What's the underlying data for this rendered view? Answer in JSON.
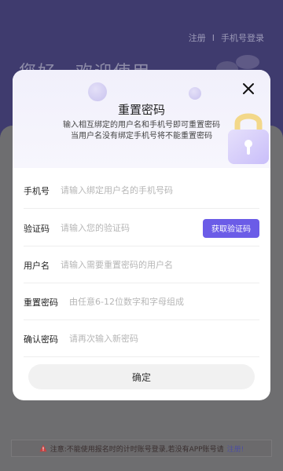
{
  "background": {
    "nav": {
      "register": "注册",
      "separator": "I",
      "phone_login": "手机号登录"
    },
    "greeting": "您好，欢迎使用",
    "notice": {
      "text": "注意:不能使用报名时的计时账号登录,若没有APP账号请",
      "link": "注册!"
    }
  },
  "modal": {
    "title": "重置密码",
    "subtitle_line1": "输入相互绑定的用户名和手机号即可重置密码",
    "subtitle_line2": "当用户名没有绑定手机号将不能重置密码",
    "fields": {
      "phone": {
        "label": "手机号",
        "placeholder": "请输入绑定用户名的手机号码",
        "value": ""
      },
      "code": {
        "label": "验证码",
        "placeholder": "请输入您的验证码",
        "value": "",
        "button": "获取验证码"
      },
      "username": {
        "label": "用户名",
        "placeholder": "请输入需要重置密码的用户名",
        "value": ""
      },
      "new_password": {
        "label": "重置密码",
        "placeholder": "由任意6-12位数字和字母组成",
        "value": ""
      },
      "confirm_password": {
        "label": "确认密码",
        "placeholder": "请再次输入新密码",
        "value": ""
      }
    },
    "confirm_button": "确定"
  },
  "colors": {
    "accent": "#6b5ce7",
    "header_bg": "#f1f0fb",
    "overlay_top": "#3f3b6e"
  },
  "icons": {
    "close": "close-icon",
    "lock": "lock-icon",
    "warning": "warning-icon"
  }
}
